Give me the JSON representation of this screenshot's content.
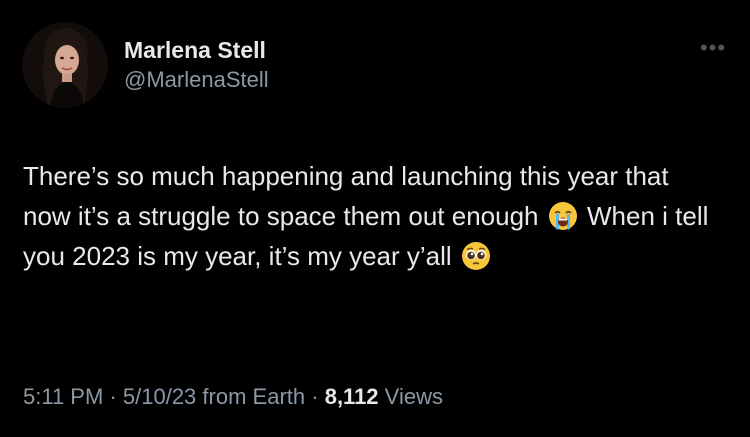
{
  "author": {
    "display_name": "Marlena Stell",
    "handle": "@MarlenaStell"
  },
  "more_menu": {
    "label": "•••"
  },
  "tweet": {
    "text_part1": "There’s so much happening and launching this year that now it’s a struggle to space them out enough",
    "emoji1": "loudly-crying-face",
    "text_part2": "When i tell you 2023 is my year, it’s my year y’all",
    "emoji2": "pleading-face"
  },
  "meta": {
    "time": "5:11 PM",
    "separator1": "·",
    "date": "5/10/23",
    "source": "from Earth",
    "separator2": "·",
    "views_count": "8,112",
    "views_label": "Views"
  },
  "colors": {
    "background": "#000000",
    "primary_text": "#e7e9ea",
    "secondary_text": "#8b98a5"
  }
}
